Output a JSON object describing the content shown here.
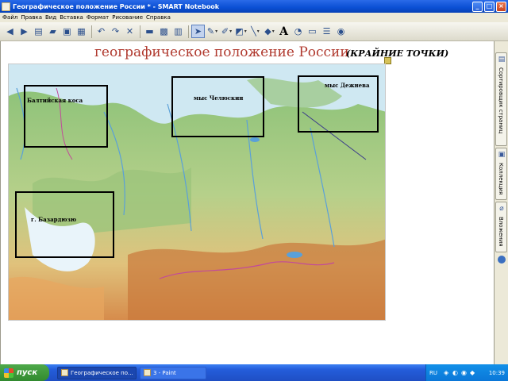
{
  "window": {
    "title": "Географическое положение России * - SMART Notebook",
    "min_label": "_",
    "max_label": "□",
    "close_label": "×"
  },
  "menu": [
    "Файл",
    "Правка",
    "Вид",
    "Вставка",
    "Формат",
    "Рисование",
    "Справка"
  ],
  "toolbar": {
    "text_tool_label": "A"
  },
  "page": {
    "title": "географическое положение России",
    "subtitle": "(КРАЙНИЕ ТОЧКИ)"
  },
  "map": {
    "labels": {
      "baltic": "Балтийская коса",
      "chelyuskin": "мыс Челюскин",
      "dezhnev": "мыс Дежнева",
      "bazardyuzyu": "г. Базардюзю"
    }
  },
  "side_tabs": [
    {
      "label": "Сортировщик страниц",
      "icon": "page-sorter-icon"
    },
    {
      "label": "Коллекция",
      "icon": "gallery-icon"
    },
    {
      "label": "Вложения",
      "icon": "attachments-icon"
    }
  ],
  "taskbar": {
    "start_label": "пуск",
    "tasks": [
      {
        "label": "Географическое по...",
        "active": true
      },
      {
        "label": "3 - Paint",
        "active": false
      }
    ],
    "tray": {
      "lang": "RU",
      "clock": "10:39"
    }
  },
  "colors": {
    "title_red": "#b0392e",
    "titlebar_blue": "#0a4fd4",
    "taskbar_blue": "#245ddb",
    "start_green": "#328a2f"
  }
}
